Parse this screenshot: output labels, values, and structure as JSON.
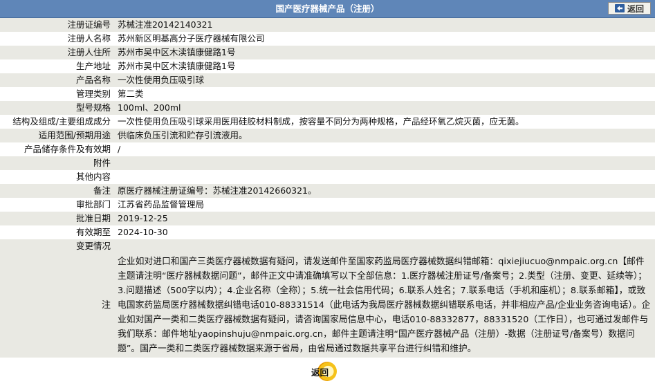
{
  "header": {
    "title": "国产医疗器械产品（注册）",
    "back_label": "返回"
  },
  "fields": [
    {
      "label": "注册证编号",
      "value": "苏械注准20142140321"
    },
    {
      "label": "注册人名称",
      "value": "苏州新区明基高分子医疗器械有限公司"
    },
    {
      "label": "注册人住所",
      "value": "苏州市吴中区木渎镇康健路1号"
    },
    {
      "label": "生产地址",
      "value": "苏州市吴中区木渎镇康健路1号"
    },
    {
      "label": "产品名称",
      "value": "一次性使用负压吸引球"
    },
    {
      "label": "管理类别",
      "value": "第二类"
    },
    {
      "label": "型号规格",
      "value": "100ml、200ml"
    },
    {
      "label": "结构及组成/主要组成成分",
      "value": "一次性使用负压吸引球采用医用硅胶材料制成，按容量不同分为两种规格，产品经环氧乙烷灭菌，应无菌。"
    },
    {
      "label": "适用范围/预期用途",
      "value": "供临床负压引流和贮存引流液用。"
    },
    {
      "label": "产品储存条件及有效期",
      "value": "/"
    },
    {
      "label": "附件",
      "value": ""
    },
    {
      "label": "其他内容",
      "value": ""
    },
    {
      "label": "备注",
      "value": "原医疗器械注册证编号：苏械注准20142660321。"
    },
    {
      "label": "审批部门",
      "value": "江苏省药品监督管理局"
    },
    {
      "label": "批准日期",
      "value": "2019-12-25"
    },
    {
      "label": "有效期至",
      "value": "2024-10-30"
    }
  ],
  "change": {
    "label": "变更情况",
    "value": ""
  },
  "note": {
    "label": "注",
    "text": "企业如对进口和国产三类医疗器械数据有疑问，请发送邮件至国家药监局医疗器械数据纠错邮箱：qixiejiucuo@nmpaic.org.cn【邮件主题请注明“医疗器械数据问题”，邮件正文中请准确填写以下全部信息：1.医疗器械注册证号/备案号；2.类型（注册、变更、延续等）；3.问题描述（500字以内）；4.企业名称（全称）；5.统一社会信用代码；6.联系人姓名；7.联系电话（手机和座机）；8.联系邮箱】，或致电国家药监局医疗器械数据纠错电话010-88331514（此电话为我局医疗器械数据纠错联系电话，并非相应产品/企业业务咨询电话）。企业如对国产一类和二类医疗器械数据有疑问，请咨询国家局信息中心，电话010-88332877，88331520（工作日），也可通过发邮件与我们联系：邮件地址yaopinshuju@nmpaic.org.cn，邮件主题请注明“国产医疗器械产品（注册）-数据（注册证号/备案号）数据问题”。国产一类和二类医疗器械数据来源于省局，由省局通过数据共享平台进行纠错和维护。"
  },
  "footer": {
    "back_label": "返回"
  },
  "colors": {
    "header_bg": "#5f86b8",
    "row_alt": "#e9e9e3"
  }
}
